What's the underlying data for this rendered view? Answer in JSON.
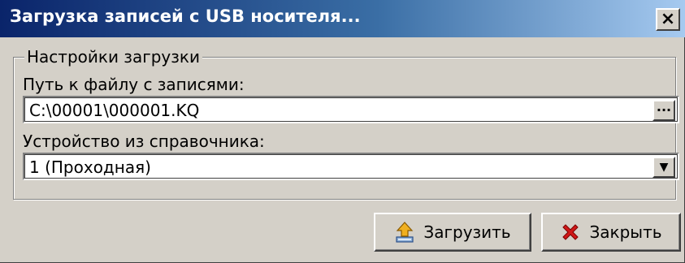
{
  "window": {
    "title": "Загрузка записей с  USB носителя...",
    "close_glyph": "×"
  },
  "group": {
    "title": "Настройки загрузки",
    "path_label": "Путь к файлу с записями:",
    "path_value": "C:\\00001\\000001.KQ",
    "browse_glyph": "···",
    "device_label": "Устройство из справочника:",
    "device_value": "1 (Проходная)",
    "dropdown_glyph": "▼"
  },
  "buttons": {
    "load_label": "Загрузить",
    "close_label": "Закрыть"
  },
  "icons": {
    "load": "upload-icon",
    "close": "red-x-icon"
  },
  "colors": {
    "title_start": "#0a246a",
    "title_end": "#a6caf0",
    "face": "#d4d0c8",
    "close_red": "#d01818"
  }
}
